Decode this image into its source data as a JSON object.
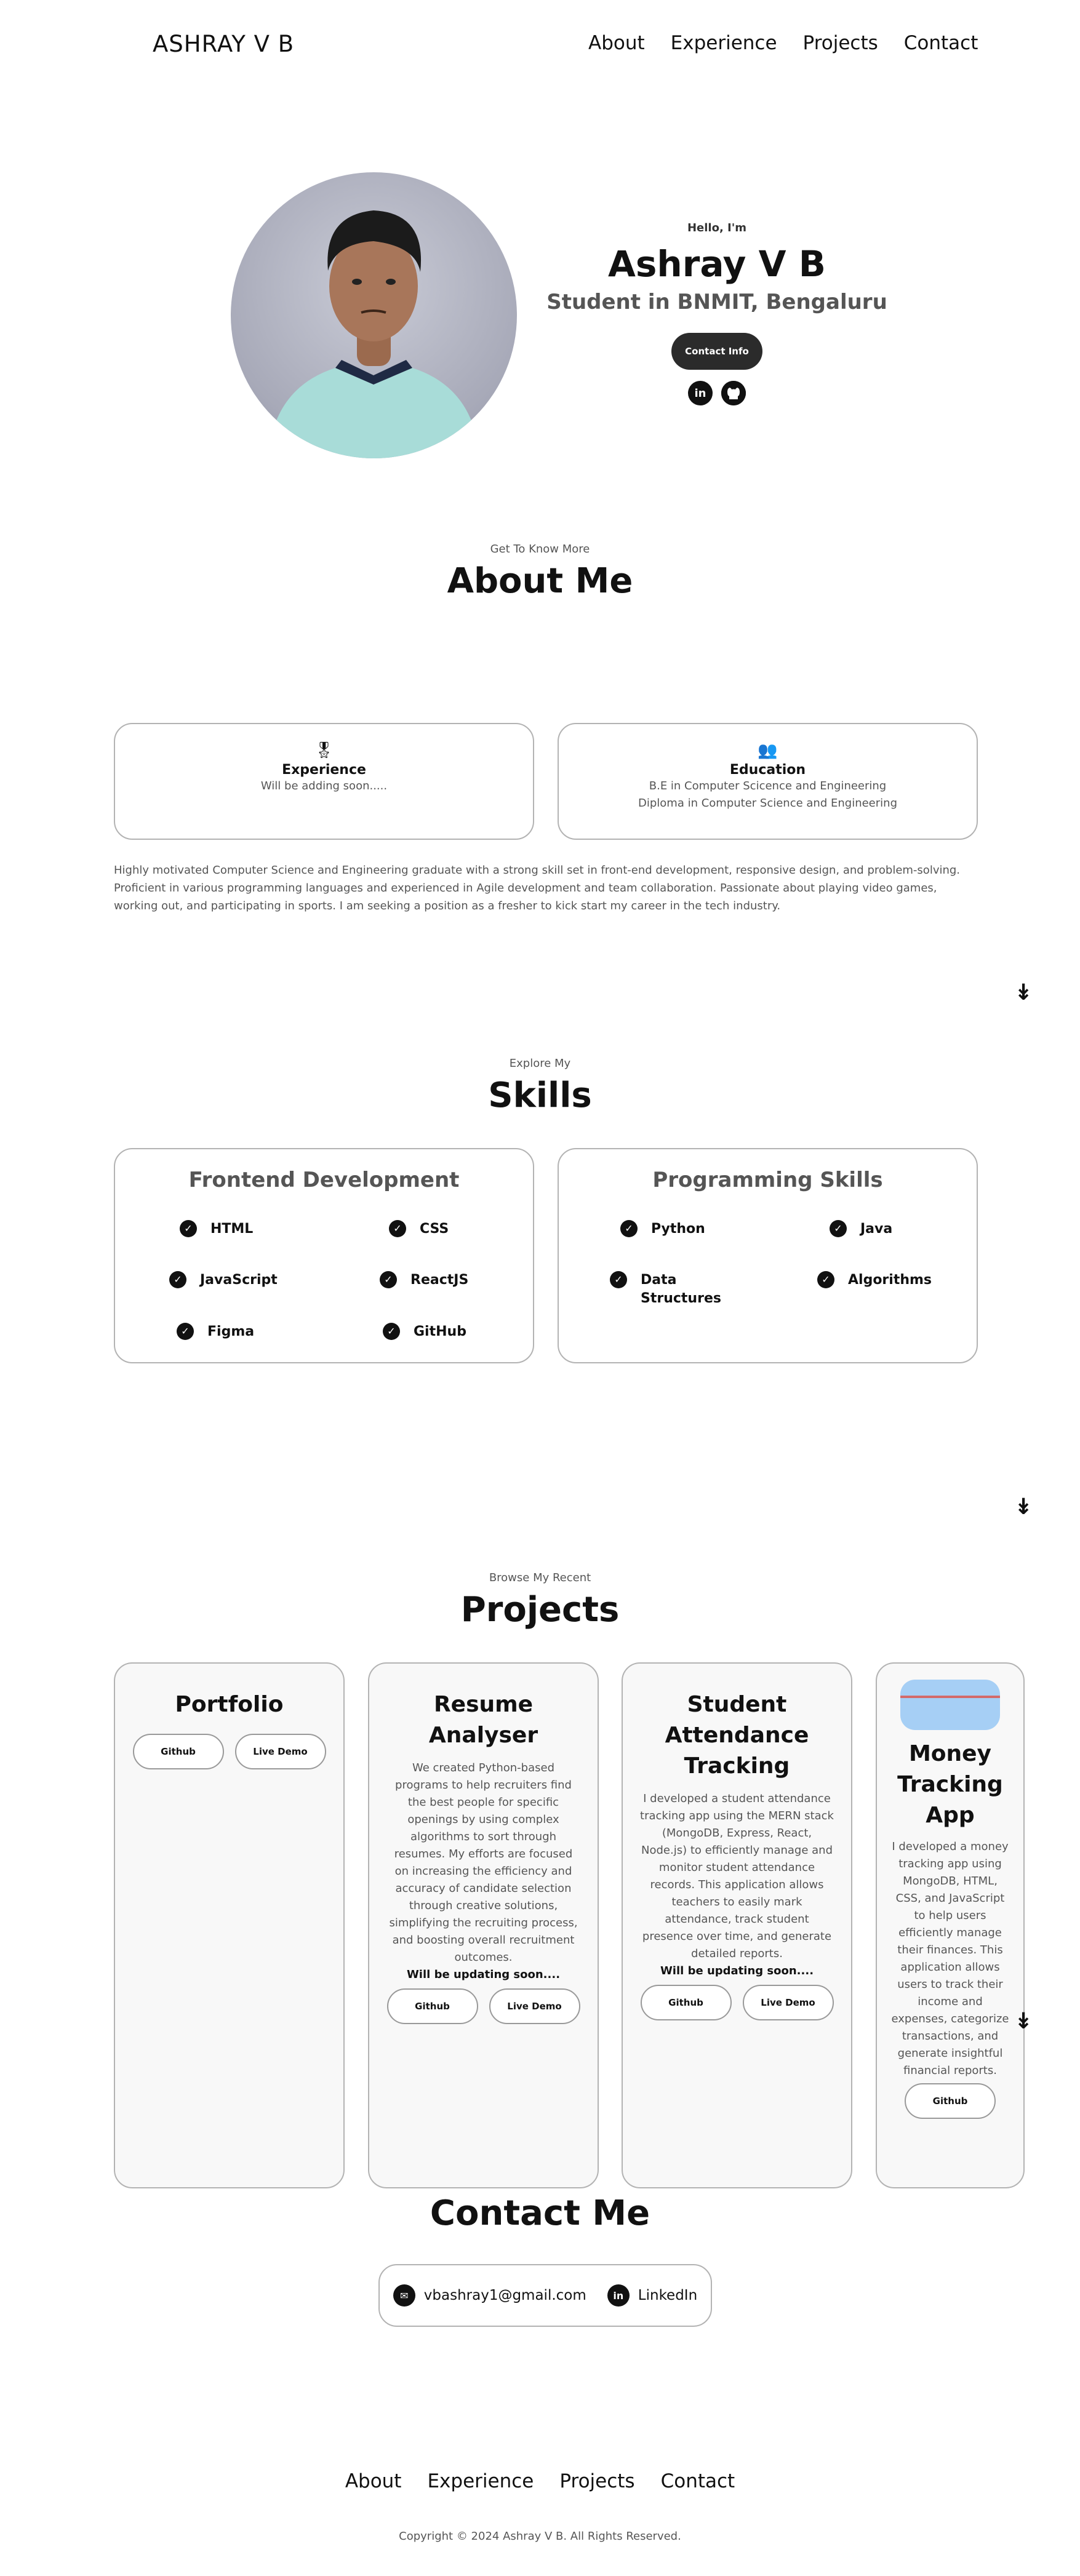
{
  "nav": {
    "brand": "ASHRAY V B",
    "links": [
      "About",
      "Experience",
      "Projects",
      "Contact"
    ]
  },
  "hero": {
    "greeting": "Hello, I'm",
    "name": "Ashray V B",
    "subtitle": "Student in BNMIT, Bengaluru",
    "contact_button": "Contact Info",
    "social": [
      "linkedin-icon",
      "github-icon"
    ]
  },
  "about": {
    "pre": "Get To Know More",
    "title": "About Me",
    "experience": {
      "title": "Experience",
      "lines": [
        "Will be adding soon....."
      ]
    },
    "education": {
      "title": "Education",
      "lines": [
        "B.E in Computer Scicence and Engineering",
        "Diploma in Computer Science and Engineering"
      ]
    },
    "paragraph": "Highly motivated Computer Science and Engineering graduate with a strong skill set in front-end development, responsive design, and problem-solving. Proficient in various programming languages and experienced in Agile development and team collaboration. Passionate about playing video games, working out, and participating in sports. I am seeking a position as a fresher to kick start my career in the tech industry."
  },
  "skills": {
    "pre": "Explore My",
    "title": "Skills",
    "frontend": {
      "title": "Frontend Development",
      "items": [
        "HTML",
        "CSS",
        "JavaScript",
        "ReactJS",
        "Figma",
        "GitHub"
      ]
    },
    "programming": {
      "title": "Programming Skills",
      "items": [
        "Python",
        "Java",
        "Data Structures",
        "Algorithms"
      ]
    }
  },
  "projects": {
    "pre": "Browse My Recent",
    "title": "Projects",
    "items": [
      {
        "title": "Portfolio",
        "desc": "",
        "note": "",
        "buttons": [
          "Github",
          "Live Demo"
        ]
      },
      {
        "title": "Resume Analyser",
        "desc": "We created Python-based programs to help recruiters find the best people for specific openings by using complex algorithms to sort through resumes. My efforts are focused on increasing the efficiency and accuracy of candidate selection through creative solutions, simplifying the recruiting process, and boosting overall recruitment outcomes.",
        "note": "Will be updating soon....",
        "buttons": [
          "Github",
          "Live Demo"
        ]
      },
      {
        "title": "Student Attendance Tracking",
        "desc": "I developed a student attendance tracking app using the MERN stack (MongoDB, Express, React, Node.js) to efficiently manage and monitor student attendance records. This application allows teachers to easily mark attendance, track student presence over time, and generate detailed reports.",
        "note": "Will be updating soon....",
        "buttons": [
          "Github",
          "Live Demo"
        ]
      },
      {
        "title": "Money Tracking App",
        "desc": "I developed a money tracking app using MongoDB, HTML, CSS, and JavaScript to help users efficiently manage their finances. This application allows users to track their income and expenses, categorize transactions, and generate insightful financial reports.",
        "note": "",
        "buttons": [
          "Github"
        ]
      }
    ]
  },
  "contact": {
    "title": "Contact Me",
    "email": "vbashray1@gmail.com",
    "linkedin": "LinkedIn"
  },
  "footer": {
    "links": [
      "About",
      "Experience",
      "Projects",
      "Contact"
    ],
    "copyright": "Copyright © 2024 Ashray V B. All Rights Reserved."
  }
}
